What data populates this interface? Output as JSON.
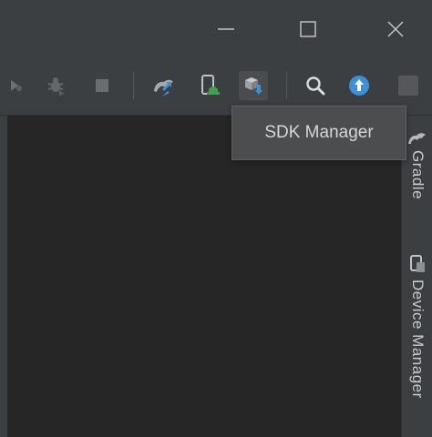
{
  "window_controls": {
    "minimize_icon": "minimize-icon",
    "maximize_icon": "maximize-icon",
    "close_icon": "close-icon"
  },
  "toolbar": {
    "icons": [
      "profile-icon",
      "debug-icon",
      "stop-icon",
      "sync-gradle-icon",
      "device-manager-icon",
      "sdk-manager-icon",
      "search-icon",
      "update-icon",
      "settings-square-icon"
    ],
    "active_item": "sdk-manager-icon",
    "accent_green": "#3fa34d",
    "accent_blue": "#3d8fd6"
  },
  "tooltip": {
    "text": "SDK Manager"
  },
  "right_sidebar": {
    "tabs": [
      {
        "label": "Gradle",
        "icon": "gradle-icon"
      },
      {
        "label": "Device Manager",
        "icon": "device-manager-icon"
      }
    ]
  }
}
